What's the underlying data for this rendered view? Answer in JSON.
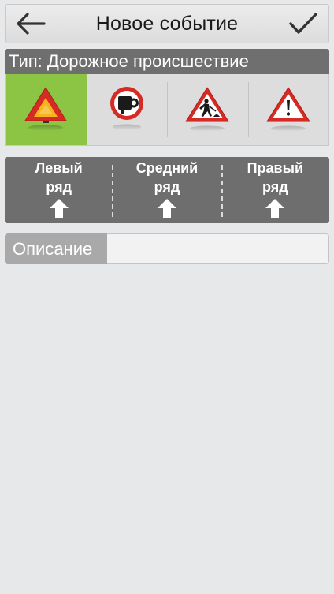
{
  "header": {
    "title": "Новое событие",
    "back_icon": "arrow-left-icon",
    "confirm_icon": "checkmark-icon"
  },
  "type_selector": {
    "header_text": "Тип: Дорожное происшествие",
    "items": [
      {
        "icon": "warning-triangle-icon",
        "selected": true
      },
      {
        "icon": "speed-camera-icon",
        "selected": false
      },
      {
        "icon": "road-works-icon",
        "selected": false
      },
      {
        "icon": "danger-exclamation-icon",
        "selected": false
      }
    ],
    "selected_color": "#8cc543"
  },
  "lanes": {
    "items": [
      {
        "label": "Левый\nряд",
        "icon": "arrow-up-icon"
      },
      {
        "label": "Средний\nряд",
        "icon": "arrow-up-icon"
      },
      {
        "label": "Правый\nряд",
        "icon": "arrow-up-icon"
      }
    ]
  },
  "description": {
    "label": "Описание",
    "value": "",
    "placeholder": ""
  },
  "colors": {
    "panel_dark": "#6e6e6e",
    "sign_red": "#d62b25",
    "background": "#e7e8e9"
  }
}
